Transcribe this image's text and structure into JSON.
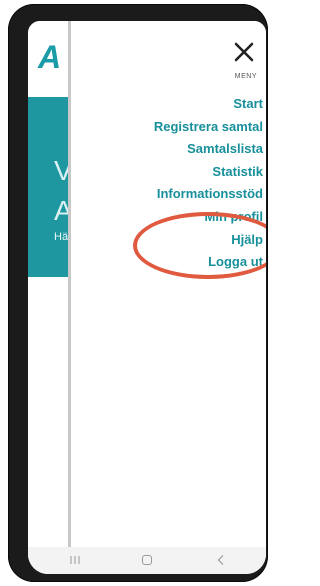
{
  "app": {
    "logo_text": "A",
    "hero_line1": "V",
    "hero_line2": "A",
    "hero_sub": "Hä"
  },
  "menu": {
    "close_label": "MENY",
    "items": [
      {
        "label": "Start"
      },
      {
        "label": "Registrera samtal"
      },
      {
        "label": "Samtalslista"
      },
      {
        "label": "Statistik"
      },
      {
        "label": "Informationsstöd"
      },
      {
        "label": "Min profil"
      },
      {
        "label": "Hjälp"
      },
      {
        "label": "Logga ut"
      }
    ]
  },
  "colors": {
    "accent": "#17909b",
    "hero_bg": "#1e97a0",
    "annotation": "#e05a3f"
  },
  "icons": {
    "close": "close-icon",
    "nav_recent": "recent-apps-icon",
    "nav_home": "home-icon",
    "nav_back": "back-icon"
  }
}
